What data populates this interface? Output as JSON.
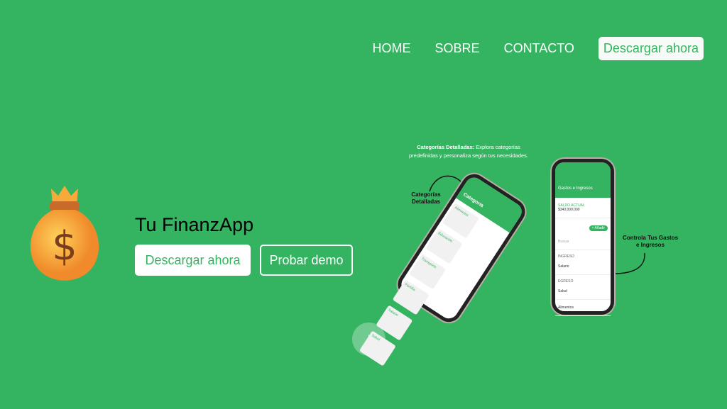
{
  "nav": {
    "items": [
      "HOME",
      "SOBRE",
      "CONTACTO"
    ],
    "download": "Descargar ahora"
  },
  "hero": {
    "title": "Tu FinanzApp",
    "primary": "Descargar ahora",
    "secondary": "Probar demo",
    "scroll_icon": "↓"
  },
  "promo": {
    "caption_bold": "Categorías Detalladas:",
    "caption_rest": " Explora categorías predefinidas y personaliza según tus necesidades.",
    "label_left": "Categorías Detalladas",
    "label_right": "Controla Tus Gastos e Ingresos",
    "phone_left": {
      "title": "Categoría",
      "tiles": [
        "Alimentos",
        "Educación",
        "Transporte",
        "Familia",
        "Salario",
        "Salud"
      ]
    },
    "phone_right": {
      "title": "Gastos e Ingresos",
      "balance_label": "SALDO ACTUAL",
      "balance": "$340,000.000",
      "add": "+ Añadir",
      "search": "Buscar",
      "income": "INGRESO",
      "expense": "EGRESO",
      "rows": [
        "Salario",
        "Salud",
        "Alimentos"
      ]
    }
  }
}
